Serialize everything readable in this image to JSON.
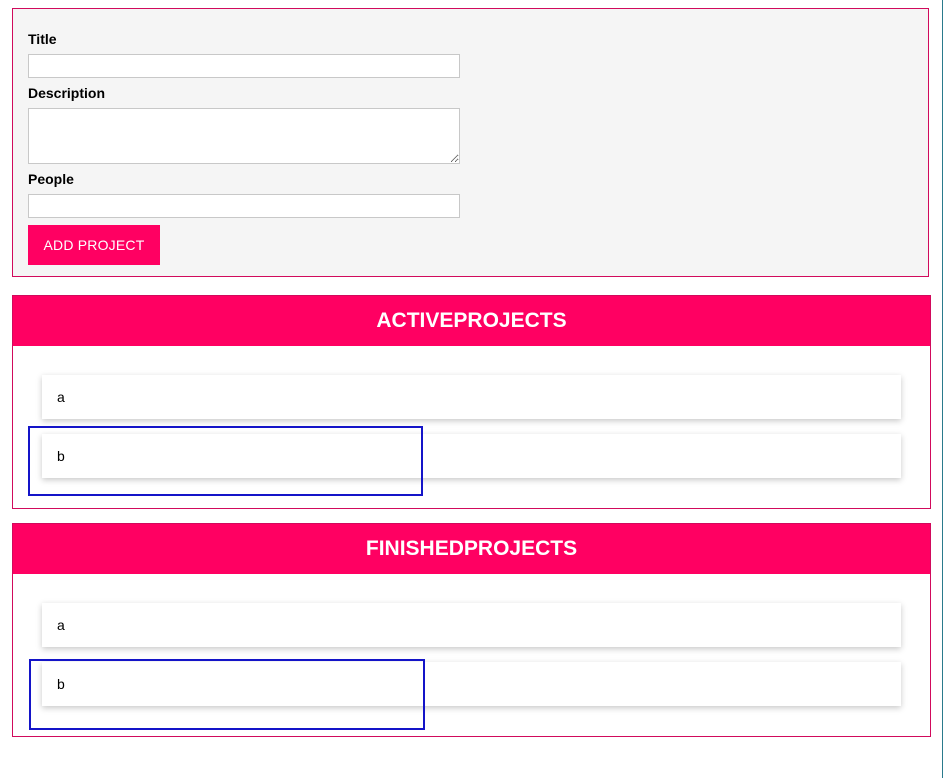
{
  "form": {
    "title_label": "Title",
    "title_value": "",
    "description_label": "Description",
    "description_value": "",
    "people_label": "People",
    "people_value": "",
    "submit_label": "ADD PROJECT"
  },
  "active_section": {
    "heading": "ACTIVEPROJECTS",
    "items": [
      {
        "title": "a"
      },
      {
        "title": "b"
      }
    ]
  },
  "finished_section": {
    "heading": "FINISHEDPROJECTS",
    "items": [
      {
        "title": "a"
      },
      {
        "title": "b"
      }
    ]
  },
  "colors": {
    "accent": "#ff0062",
    "border": "#d10a5c",
    "form_bg": "#f5f5f5",
    "selection_outline": "#1414c8"
  }
}
